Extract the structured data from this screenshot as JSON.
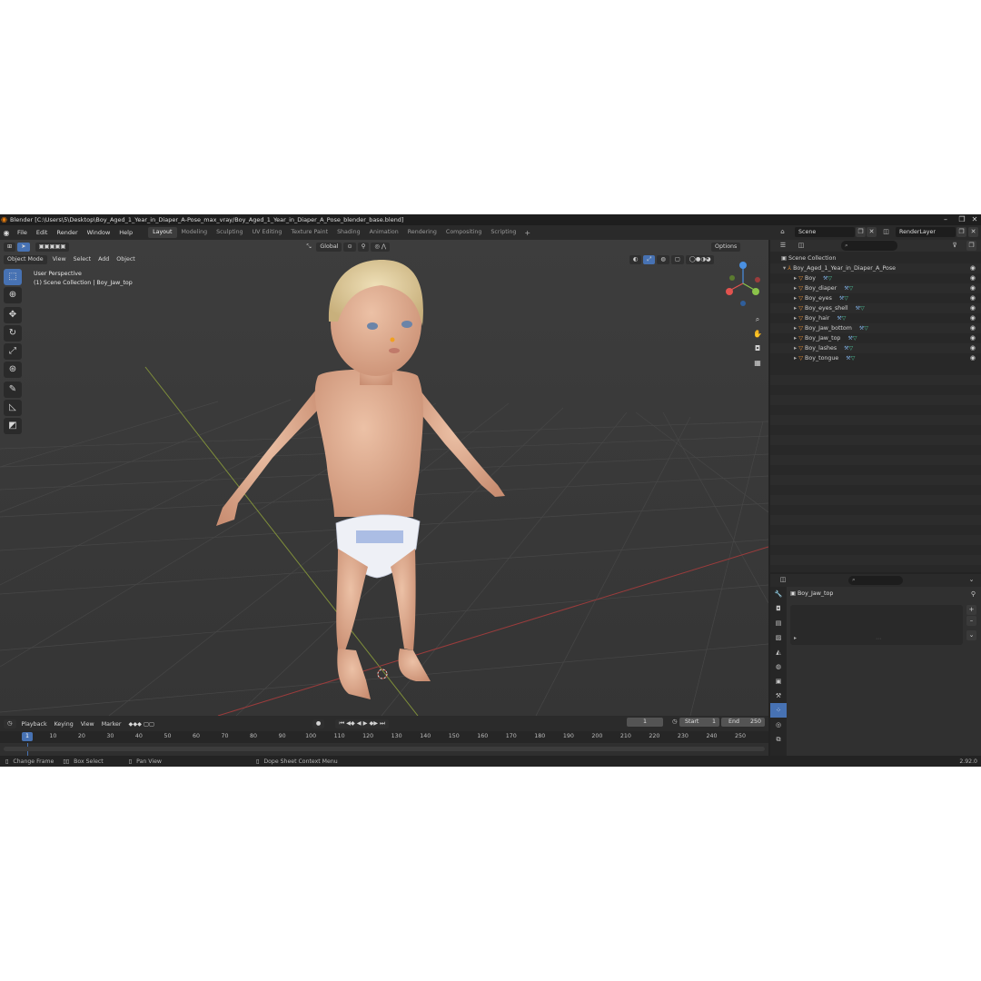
{
  "titlebar": {
    "title": "Blender [C:\\Users\\5\\Desktop\\Boy_Aged_1_Year_in_Diaper_A-Pose_max_vray/Boy_Aged_1_Year_in_Diaper_A_Pose_blender_base.blend]"
  },
  "menu": [
    "File",
    "Edit",
    "Render",
    "Window",
    "Help"
  ],
  "workspaces": [
    "Layout",
    "Modeling",
    "Sculpting",
    "UV Editing",
    "Texture Paint",
    "Shading",
    "Animation",
    "Rendering",
    "Compositing",
    "Scripting"
  ],
  "scene": {
    "name": "Scene",
    "render_layer": "RenderLayer"
  },
  "viewport": {
    "transform_orientation": "Global",
    "options_label": "Options",
    "mode": "Object Mode",
    "menus": [
      "View",
      "Select",
      "Add",
      "Object"
    ],
    "perspective_label": "User Perspective",
    "collection_label": "(1) Scene Collection | Boy_Jaw_top"
  },
  "outliner": {
    "root": "Scene Collection",
    "parent": "Boy_Aged_1_Year_in_Diaper_A_Pose",
    "objects": [
      "Boy",
      "Boy_diaper",
      "Boy_eyes",
      "Boy_eyes_shell",
      "Boy_hair",
      "Boy_Jaw_bottom",
      "Boy_Jaw_top",
      "Boy_lashes",
      "Boy_tongue"
    ]
  },
  "properties": {
    "active_object": "Boy_Jaw_top"
  },
  "timeline": {
    "menus": [
      "Playback",
      "Keying",
      "View",
      "Marker"
    ],
    "current_frame": "1",
    "start_label": "Start",
    "start": "1",
    "end_label": "End",
    "end": "250",
    "ticks": [
      "10",
      "20",
      "30",
      "40",
      "50",
      "60",
      "70",
      "80",
      "90",
      "100",
      "110",
      "120",
      "130",
      "140",
      "150",
      "160",
      "170",
      "180",
      "190",
      "200",
      "210",
      "220",
      "230",
      "240",
      "250"
    ]
  },
  "statusbar": {
    "items": [
      "Change Frame",
      "Box Select",
      "Pan View",
      "Dope Sheet Context Menu"
    ],
    "version": "2.92.0"
  },
  "colors": {
    "accent": "#4772b3",
    "object_icon": "#e48a2f",
    "mesh_icon": "#4ec39a",
    "x_axis": "#e2534f",
    "y_axis": "#8bc34a",
    "z_axis": "#4a90e2"
  }
}
